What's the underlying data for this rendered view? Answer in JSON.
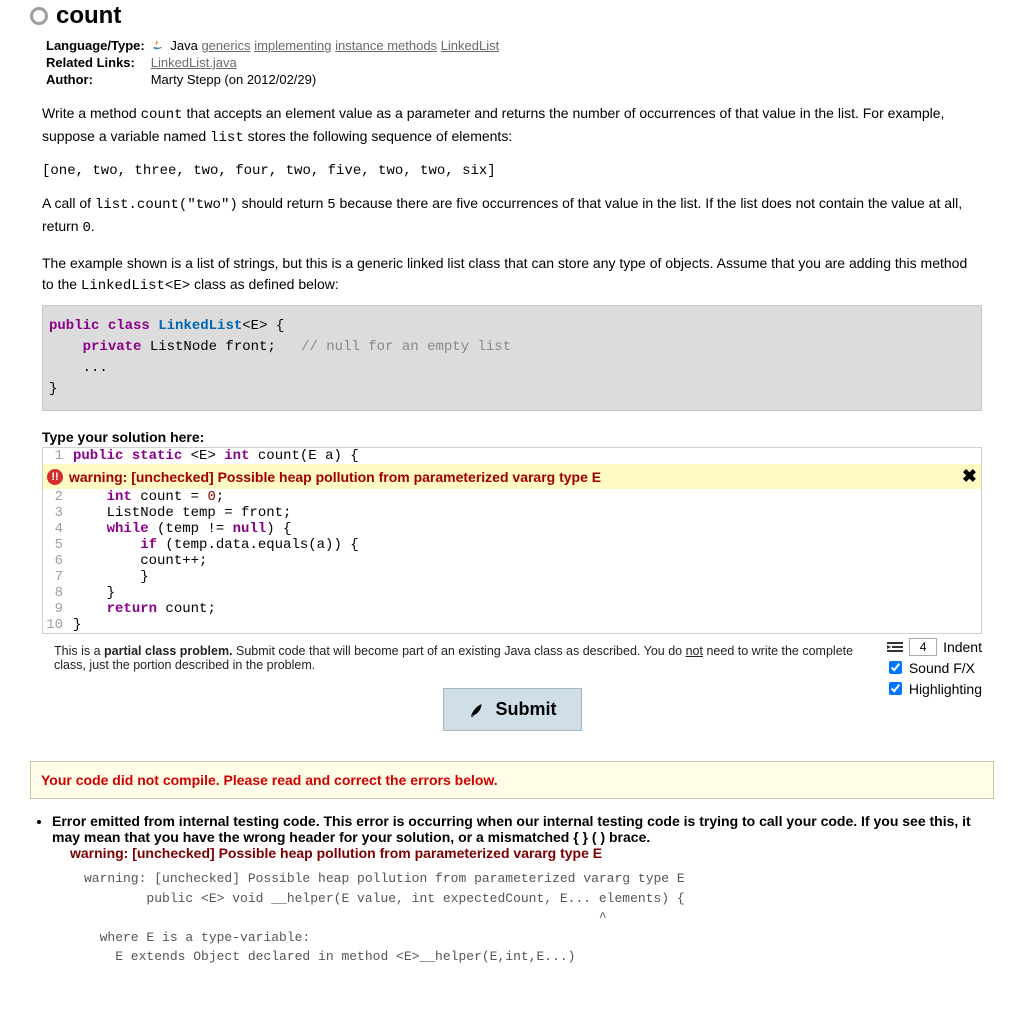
{
  "title": "count",
  "meta": {
    "lang_label": "Language/Type:",
    "links_label": "Related Links:",
    "author_label": "Author:",
    "language": "Java",
    "tags": [
      "generics",
      "implementing",
      "instance methods",
      "LinkedList"
    ],
    "related_links": [
      "LinkedList.java"
    ],
    "author": "Marty Stepp (on 2012/02/29)"
  },
  "description": {
    "p1a": "Write a method ",
    "p1_code1": "count",
    "p1b": " that accepts an element value as a parameter and returns the number of occurrences of that value in the list. For example, suppose a variable named ",
    "p1_code2": "list",
    "p1c": " stores the following sequence of elements:",
    "example_list": "[one, two, three, two, four, two, five, two, two, six]",
    "p2a": "A call of ",
    "p2_code1": "list.count(\"two\")",
    "p2b": " should return ",
    "p2_code2": "5",
    "p2c": " because there are five occurrences of that value in the list. If the list does not contain the value at all, return ",
    "p2_code3": "0",
    "p2d": ".",
    "p3a": "The example shown is a list of strings, but this is a generic linked list class that can store any type of objects. Assume that you are adding this method to the ",
    "p3_code1": "LinkedList<E>",
    "p3b": " class as defined below:"
  },
  "class_code": {
    "l1_kw1": "public",
    "l1_kw2": "class",
    "l1_typ": "LinkedList",
    "l1_rest": "<E> {",
    "l2_kw": "private",
    "l2_rest": " ListNode front;   ",
    "l2_com": "// null for an empty list",
    "l3": "    ...",
    "l4": "}"
  },
  "solution_label": "Type your solution here:",
  "code": {
    "l1_kw1": "public",
    "l1_kw2": "static",
    "l1_rest1": " <E> ",
    "l1_kw3": "int",
    "l1_rest2": " count(E a) {",
    "warning": "warning: [unchecked] Possible heap pollution from parameterized vararg type E",
    "l2_kw": "int",
    "l2_rest": " count = ",
    "l2_num": "0",
    "l2_semi": ";",
    "l3": "    ListNode temp = front;",
    "l4_kw": "while",
    "l4_rest": " (temp != ",
    "l4_kw2": "null",
    "l4_rest2": ") {",
    "l5_kw": "if",
    "l5_rest": " (temp.data.equals(a)) {",
    "l6": "        count++;",
    "l7": "        }",
    "l8": "    }",
    "l9_kw": "return",
    "l9_rest": " count;",
    "l10": "}"
  },
  "lineno": {
    "n1": "1",
    "n2": "2",
    "n3": "3",
    "n4": "4",
    "n5": "5",
    "n6": "6",
    "n7": "7",
    "n8": "8",
    "n9": "9",
    "n10": "10"
  },
  "note_a": "This is a ",
  "note_bold": "partial class problem.",
  "note_b": " Submit code that will become part of an existing Java class as described. You do ",
  "note_u": "not",
  "note_c": " need to write the complete class, just the portion described in the problem.",
  "controls": {
    "submit": "Submit",
    "indent_label": "Indent",
    "indent_value": "4",
    "sound_label": "Sound F/X",
    "highlight_label": "Highlighting"
  },
  "error_banner": "Your code did not compile. Please read and correct the errors below.",
  "error": {
    "head": "Error emitted from internal testing code. This error is occurring when our internal testing code is trying to call your code. If you see this, it may mean that you have the wrong header for your solution, or a mismatched { } ( ) brace.",
    "sub": "warning: [unchecked] Possible heap pollution from parameterized vararg type E",
    "compiler": "warning: [unchecked] Possible heap pollution from parameterized vararg type E\n        public <E> void __helper(E value, int expectedCount, E... elements) {\n                                                                  ^\n  where E is a type-variable:\n    E extends Object declared in method <E>__helper(E,int,E...)"
  }
}
